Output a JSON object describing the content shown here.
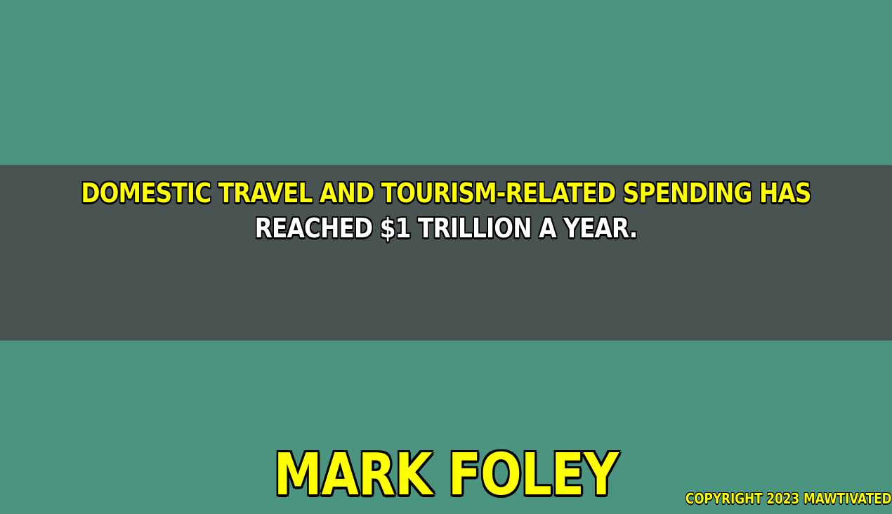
{
  "quote": {
    "line1": "DOMESTIC TRAVEL AND TOURISM-RELATED SPENDING HAS",
    "line2": "REACHED $1 TRILLION A YEAR."
  },
  "author": "MARK FOLEY",
  "copyright": "COPYRIGHT 2023 MAWTIVATED",
  "colors": {
    "background": "#4a9480",
    "band": "#495351",
    "highlight_text": "#ffff00",
    "body_text": "#ffffff",
    "outline": "#000000"
  }
}
